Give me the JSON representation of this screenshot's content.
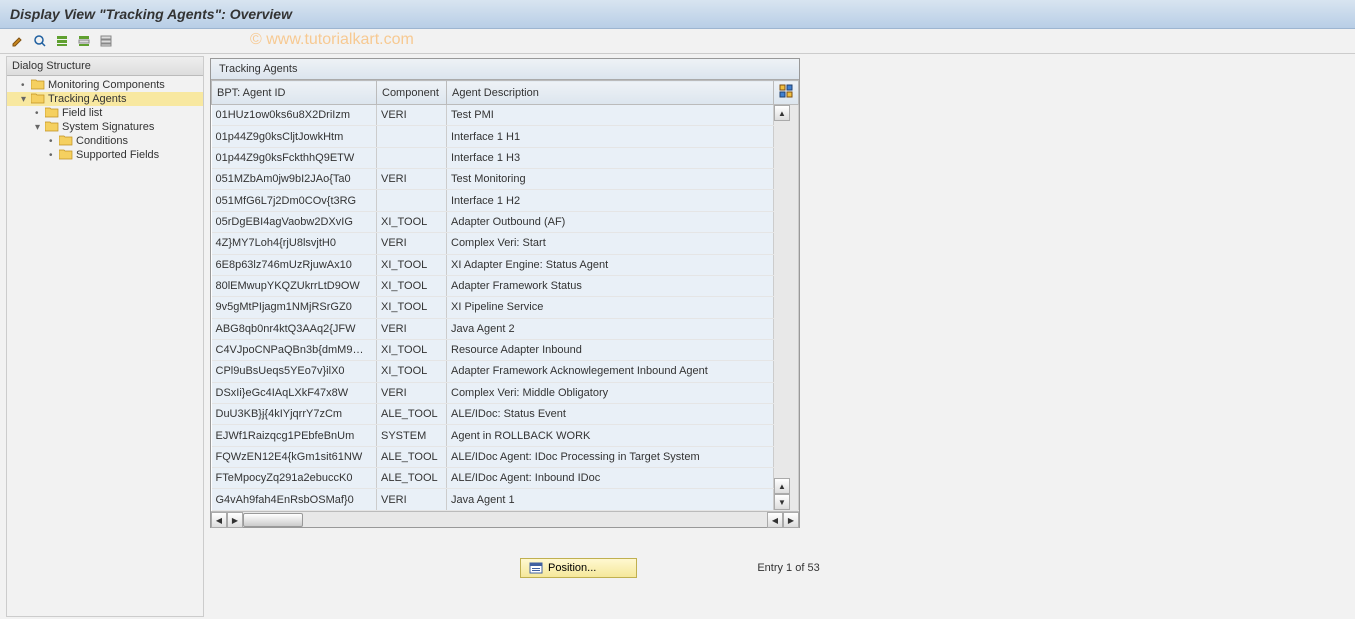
{
  "header": {
    "title": "Display View \"Tracking Agents\": Overview"
  },
  "watermark": "© www.tutorialkart.com",
  "sidebar": {
    "title": "Dialog Structure",
    "items": [
      {
        "label": "Monitoring Components",
        "indent": 1,
        "toggle": "•",
        "selected": false
      },
      {
        "label": "Tracking Agents",
        "indent": 1,
        "toggle": "▾",
        "selected": true
      },
      {
        "label": "Field list",
        "indent": 2,
        "toggle": "•",
        "selected": false
      },
      {
        "label": "System Signatures",
        "indent": 2,
        "toggle": "▾",
        "selected": false
      },
      {
        "label": "Conditions",
        "indent": 3,
        "toggle": "•",
        "selected": false
      },
      {
        "label": "Supported Fields",
        "indent": 3,
        "toggle": "•",
        "selected": false
      }
    ]
  },
  "table": {
    "title": "Tracking Agents",
    "columns": [
      "BPT: Agent ID",
      "Component",
      "Agent Description"
    ],
    "rows": [
      {
        "agent_id": "01HUz1ow0ks6u8X2DriIzm",
        "component": "VERI",
        "description": "Test PMI"
      },
      {
        "agent_id": "01p44Z9g0ksCljtJowkHtm",
        "component": "",
        "description": "Interface 1 H1"
      },
      {
        "agent_id": "01p44Z9g0ksFckthhQ9ETW",
        "component": "",
        "description": "Interface 1 H3"
      },
      {
        "agent_id": "051MZbAm0jw9bI2JAo{Ta0",
        "component": "VERI",
        "description": "Test Monitoring"
      },
      {
        "agent_id": "051MfG6L7j2Dm0COv{t3RG",
        "component": "",
        "description": "Interface 1 H2"
      },
      {
        "agent_id": "05rDgEBI4agVaobw2DXvIG",
        "component": "XI_TOOL",
        "description": "Adapter Outbound (AF)"
      },
      {
        "agent_id": "4Z}MY7Loh4{rjU8lsvjtH0",
        "component": "VERI",
        "description": "Complex Veri: Start"
      },
      {
        "agent_id": "6E8p63lz746mUzRjuwAx10",
        "component": "XI_TOOL",
        "description": "XI Adapter Engine: Status Agent"
      },
      {
        "agent_id": "80lEMwupYKQZUkrrLtD9OW",
        "component": "XI_TOOL",
        "description": "Adapter Framework Status"
      },
      {
        "agent_id": "9v5gMtPIjagm1NMjRSrGZ0",
        "component": "XI_TOOL",
        "description": "XI Pipeline Service"
      },
      {
        "agent_id": "ABG8qb0nr4ktQ3AAq2{JFW",
        "component": "VERI",
        "description": "Java Agent 2"
      },
      {
        "agent_id": "C4VJpoCNPaQBn3b{dmM9…",
        "component": "XI_TOOL",
        "description": "Resource Adapter Inbound"
      },
      {
        "agent_id": "CPl9uBsUeqs5YEo7v}ilX0",
        "component": "XI_TOOL",
        "description": "Adapter Framework Acknowlegement Inbound Agent"
      },
      {
        "agent_id": "DSxIi}eGc4IAqLXkF47x8W",
        "component": "VERI",
        "description": "Complex Veri: Middle Obligatory"
      },
      {
        "agent_id": "DuU3KB}j{4kIYjqrrY7zCm",
        "component": "ALE_TOOL",
        "description": "ALE/IDoc: Status Event"
      },
      {
        "agent_id": "EJWf1Raizqcg1PEbfeBnUm",
        "component": "SYSTEM",
        "description": "Agent in ROLLBACK WORK"
      },
      {
        "agent_id": "FQWzEN12E4{kGm1sit61NW",
        "component": "ALE_TOOL",
        "description": "ALE/IDoc Agent: IDoc Processing in Target System"
      },
      {
        "agent_id": "FTeMpocyZq291a2ebuccK0",
        "component": "ALE_TOOL",
        "description": "ALE/IDoc Agent: Inbound IDoc"
      },
      {
        "agent_id": "G4vAh9fah4EnRsbOSMaf}0",
        "component": "VERI",
        "description": "Java Agent 1"
      }
    ]
  },
  "footer": {
    "position_label": "Position...",
    "entry_text": "Entry 1 of 53"
  }
}
